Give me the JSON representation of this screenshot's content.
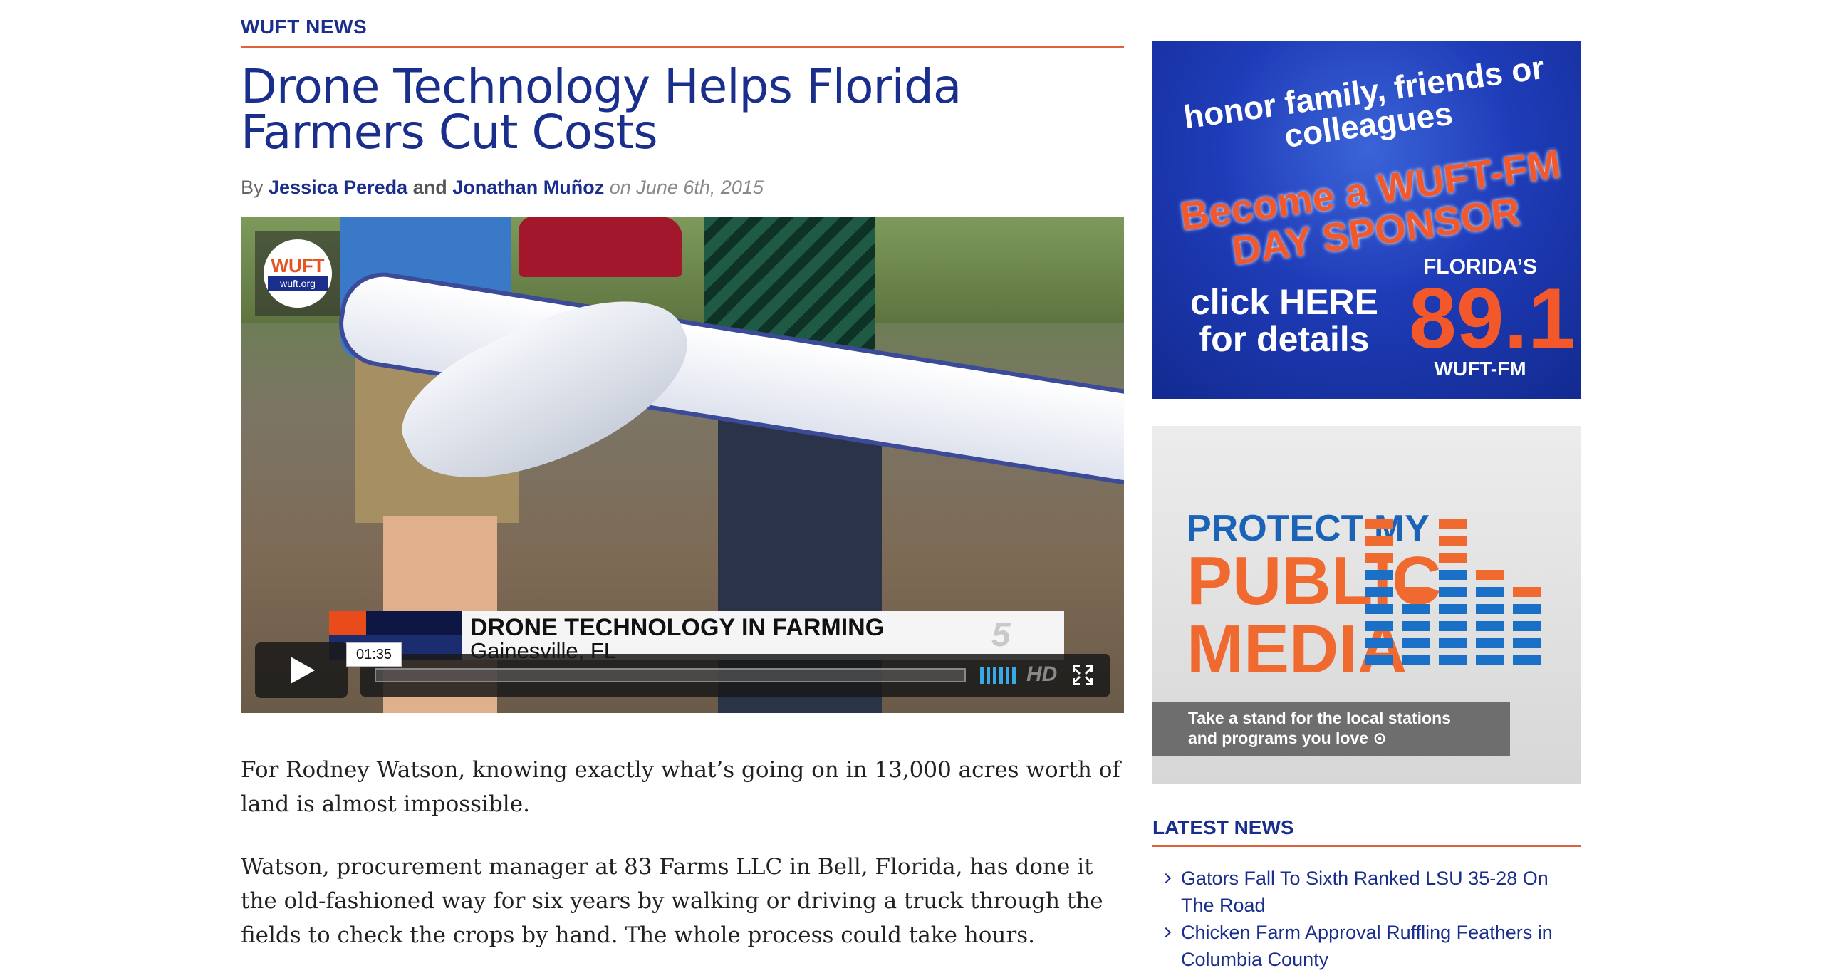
{
  "article": {
    "section": "WUFT NEWS",
    "title": "Drone Technology Helps Florida Farmers Cut Costs",
    "byline": {
      "prefix": "By",
      "author1": "Jessica Pereda",
      "joiner": "and",
      "author2": "Jonathan Muñoz",
      "date": "on June 6th, 2015"
    },
    "paragraphs": [
      "For Rodney Watson, knowing exactly what’s going on in 13,000 acres worth of land is almost impossible.",
      "Watson, procurement manager at 83 Farms LLC in Bell, Florida, has done it the old-fashioned way for six years by walking or driving a truck through the fields to check the crops by hand. The whole process could take hours."
    ]
  },
  "video": {
    "logo_text": "WUFT",
    "logo_url": "wuft.org",
    "lower_third_title": "DRONE TECHNOLOGY IN FARMING",
    "lower_third_location": "Gainesville, FL",
    "channel_mark": "5",
    "time_tooltip": "01:35",
    "hd_label": "HD",
    "progress": 0,
    "accent_color": "#38a9e6"
  },
  "ads": {
    "sponsor": {
      "line1": "honor family, friends or colleagues",
      "line2": "Become a WUFT-FM DAY SPONSOR",
      "cta": "click HERE for details",
      "floridas": "FLORIDA’S",
      "frequency": "89.1",
      "call_sign": "WUFT-FM"
    },
    "protect": {
      "line1": "PROTECT MY",
      "line2": "PUBLIC",
      "line3": "MEDIA",
      "tagline1": "Take a stand for the local stations",
      "tagline2": "and programs you love ⊙"
    }
  },
  "sidebar": {
    "latest_label": "LATEST NEWS",
    "items": [
      "Gators Fall To Sixth Ranked LSU 35-28 On The Road",
      "Chicken Farm Approval Ruffling Feathers in Columbia County"
    ]
  },
  "colors": {
    "brand_navy": "#1a2e8c",
    "rule_orange": "#e0623a"
  }
}
